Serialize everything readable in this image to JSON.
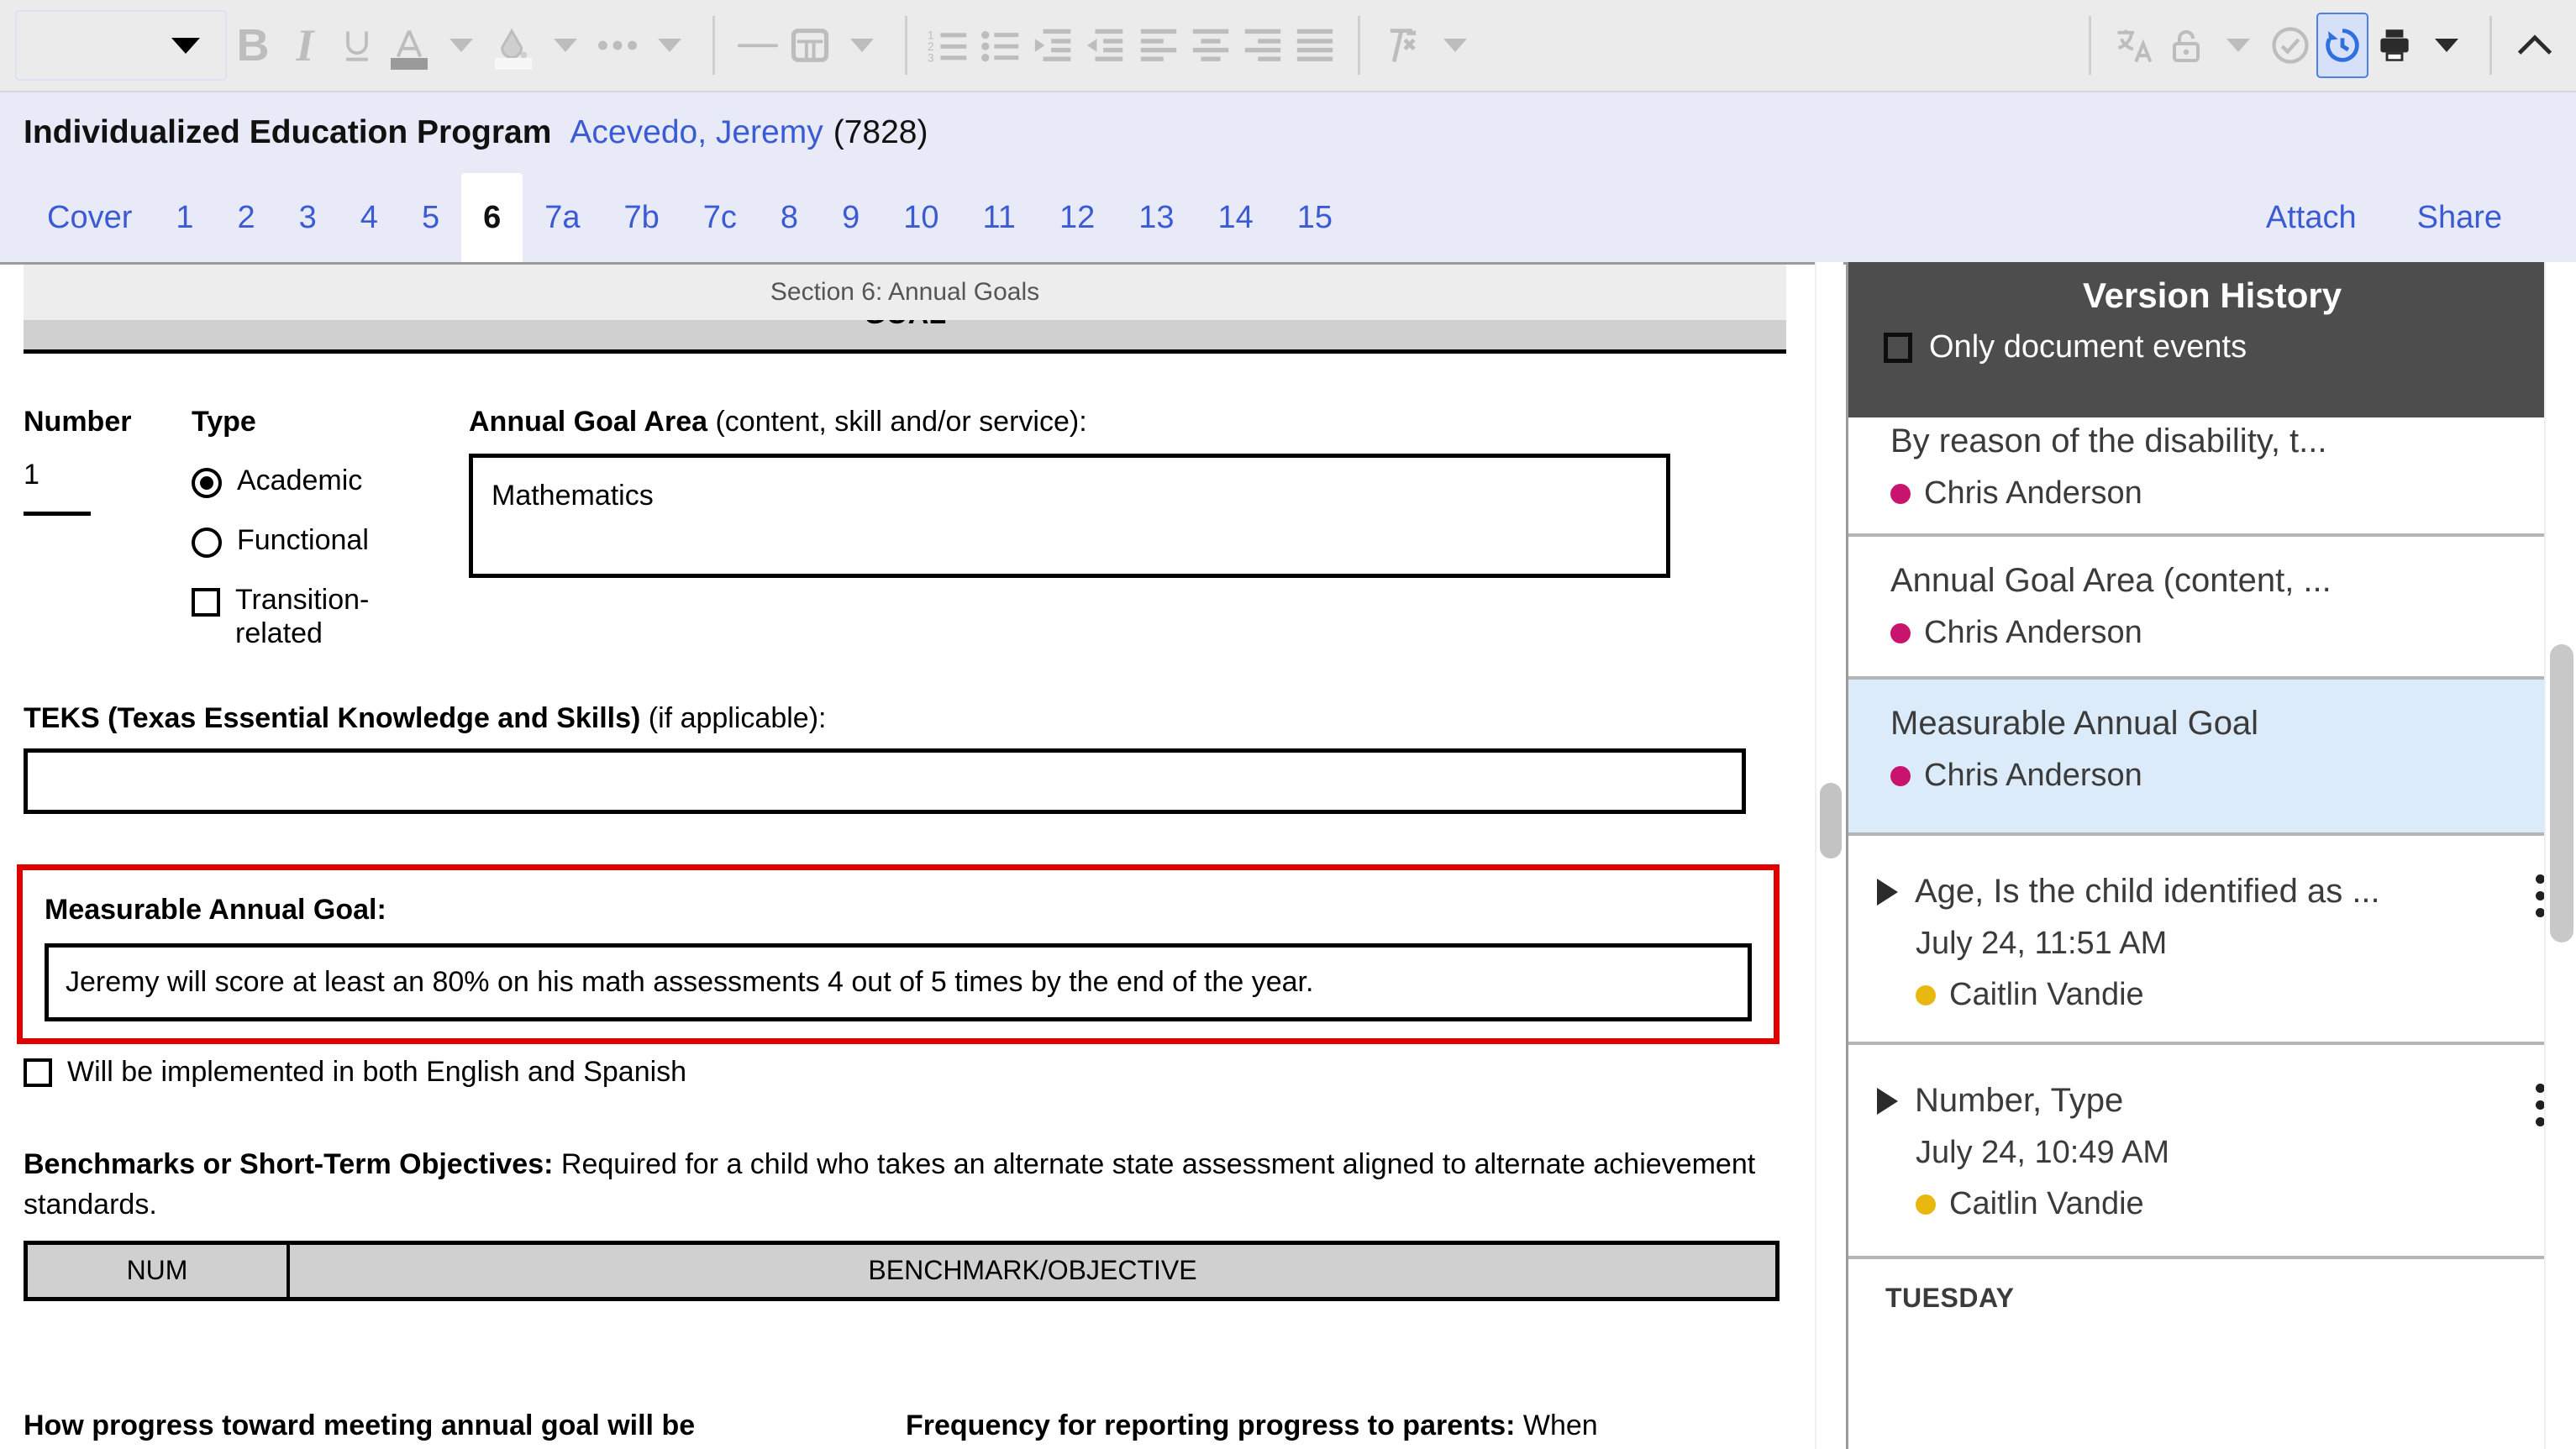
{
  "toolbar": {
    "style_combo": {
      "value": "",
      "icon": "chevron-down-icon"
    },
    "buttons": [
      {
        "name": "bold-button",
        "glyph": "B",
        "label": "Bold"
      },
      {
        "name": "italic-button",
        "glyph": "I",
        "label": "Italic"
      },
      {
        "name": "underline-button",
        "glyph": "U",
        "label": "Underline"
      },
      {
        "name": "font-color-button",
        "glyph": "A",
        "label": "Font color",
        "swatch": "#9a9a9a"
      },
      {
        "name": "highlight-color-button",
        "glyph": "drop",
        "label": "Highlight color",
        "swatch": "#f7f7f7"
      },
      {
        "name": "more-formatting-button",
        "glyph": "…",
        "label": "More formatting"
      },
      {
        "name": "horizontal-rule-button",
        "glyph": "—",
        "label": "Horizontal line"
      },
      {
        "name": "table-button",
        "glyph": "table",
        "label": "Insert table"
      },
      {
        "name": "numbered-list-button",
        "glyph": "ol",
        "label": "Numbered list"
      },
      {
        "name": "bulleted-list-button",
        "glyph": "ul",
        "label": "Bulleted list"
      },
      {
        "name": "indent-increase-button",
        "glyph": "indent",
        "label": "Increase indent"
      },
      {
        "name": "indent-decrease-button",
        "glyph": "outdent",
        "label": "Decrease indent"
      },
      {
        "name": "align-left-button",
        "glyph": "alignleft",
        "label": "Align left"
      },
      {
        "name": "align-center-button",
        "glyph": "aligncenter",
        "label": "Align center"
      },
      {
        "name": "align-right-button",
        "glyph": "alignright",
        "label": "Align right"
      },
      {
        "name": "align-justify-button",
        "glyph": "justify",
        "label": "Justify"
      },
      {
        "name": "clear-formatting-button",
        "glyph": "clearformat",
        "label": "Clear formatting"
      },
      {
        "name": "translate-button",
        "glyph": "translate",
        "label": "Translate"
      },
      {
        "name": "lock-button",
        "glyph": "lock",
        "label": "Lock"
      },
      {
        "name": "check-button",
        "glyph": "check",
        "label": "Check"
      },
      {
        "name": "version-history-button",
        "glyph": "history",
        "label": "Version History",
        "active": true
      },
      {
        "name": "print-button",
        "glyph": "print",
        "label": "Print"
      },
      {
        "name": "collapse-toolbar-button",
        "glyph": "^",
        "label": "Collapse toolbar"
      }
    ],
    "accent_active": "#4f7fe0",
    "bg": "#ebebeb"
  },
  "header": {
    "title": "Individualized Education Program",
    "student_name": "Acevedo, Jeremy",
    "student_id": "(7828)",
    "link_color": "#3b5bd4"
  },
  "tabs": {
    "items": [
      {
        "label": "Cover",
        "active": false
      },
      {
        "label": "1",
        "active": false
      },
      {
        "label": "2",
        "active": false
      },
      {
        "label": "3",
        "active": false
      },
      {
        "label": "4",
        "active": false
      },
      {
        "label": "5",
        "active": false
      },
      {
        "label": "6",
        "active": true
      },
      {
        "label": "7a",
        "active": false
      },
      {
        "label": "7b",
        "active": false
      },
      {
        "label": "7c",
        "active": false
      },
      {
        "label": "8",
        "active": false
      },
      {
        "label": "9",
        "active": false
      },
      {
        "label": "10",
        "active": false
      },
      {
        "label": "11",
        "active": false
      },
      {
        "label": "12",
        "active": false
      },
      {
        "label": "13",
        "active": false
      },
      {
        "label": "14",
        "active": false
      },
      {
        "label": "15",
        "active": false
      }
    ],
    "actions": [
      {
        "label": "Attach",
        "name": "attach-button"
      },
      {
        "label": "Share",
        "name": "share-button"
      }
    ]
  },
  "document": {
    "section_label": "Section 6: Annual Goals",
    "goal_band": "GOAL",
    "number_label": "Number",
    "number_value": "1",
    "type_label": "Type",
    "type_options": [
      {
        "label": "Academic",
        "control": "radio",
        "checked": true
      },
      {
        "label": "Functional",
        "control": "radio",
        "checked": false
      },
      {
        "label": "Transition-related",
        "control": "checkbox",
        "checked": false
      }
    ],
    "goal_area_label_bold": "Annual Goal Area",
    "goal_area_label_rest": " (content, skill and/or service):",
    "goal_area_value": "Mathematics",
    "teks_label_bold": "TEKS (Texas Essential Knowledge and Skills)",
    "teks_label_rest": " (if applicable):",
    "teks_value": "",
    "measurable_goal_label": "Measurable Annual Goal:",
    "measurable_goal_value": "Jeremy will score at least an 80% on his math assessments 4 out of 5 times by the end of the year.",
    "bilingual_label": "Will be implemented in both English and Spanish",
    "bilingual_checked": false,
    "benchmarks_label_bold": "Benchmarks or Short-Term Objectives:",
    "benchmarks_label_rest": " Required for a child who takes an alternate state assessment aligned to alternate achievement standards.",
    "benchmarks_table": {
      "columns": [
        "NUM",
        "BENCHMARK/OBJECTIVE"
      ],
      "rows": []
    },
    "progress_method_label": "How progress toward meeting annual goal will be",
    "progress_frequency_label_bold": "Frequency for reporting progress to parents:",
    "progress_frequency_label_rest": " When",
    "highlight_color": "#e00000"
  },
  "version_history": {
    "panel_title": "Version History",
    "filter_label": "Only document events",
    "filter_checked": false,
    "header_bg": "#4d4d4d",
    "selected_bg": "#dcebf9",
    "entries": [
      {
        "title": "By reason of the disability, t...",
        "time": "",
        "user": "Chris Anderson",
        "dot_color": "#c8146e",
        "selected": false,
        "expandable": false,
        "has_kebab": false,
        "clipped_top": true
      },
      {
        "title": "Annual Goal Area (content, ...",
        "time": "",
        "user": "Chris Anderson",
        "dot_color": "#c8146e",
        "selected": false,
        "expandable": false,
        "has_kebab": false,
        "clipped_top": false
      },
      {
        "title": "Measurable Annual Goal",
        "time": "",
        "user": "Chris Anderson",
        "dot_color": "#c8146e",
        "selected": true,
        "expandable": false,
        "has_kebab": false,
        "clipped_top": false
      },
      {
        "title": "Age, Is the child identified as ...",
        "time": "July 24, 11:51 AM",
        "user": "Caitlin Vandie",
        "dot_color": "#e8b810",
        "selected": false,
        "expandable": true,
        "has_kebab": true,
        "clipped_top": false
      },
      {
        "title": "Number, Type",
        "time": "July 24, 10:49 AM",
        "user": "Caitlin Vandie",
        "dot_color": "#e8b810",
        "selected": false,
        "expandable": true,
        "has_kebab": true,
        "clipped_top": false
      }
    ],
    "day_group": "TUESDAY"
  }
}
